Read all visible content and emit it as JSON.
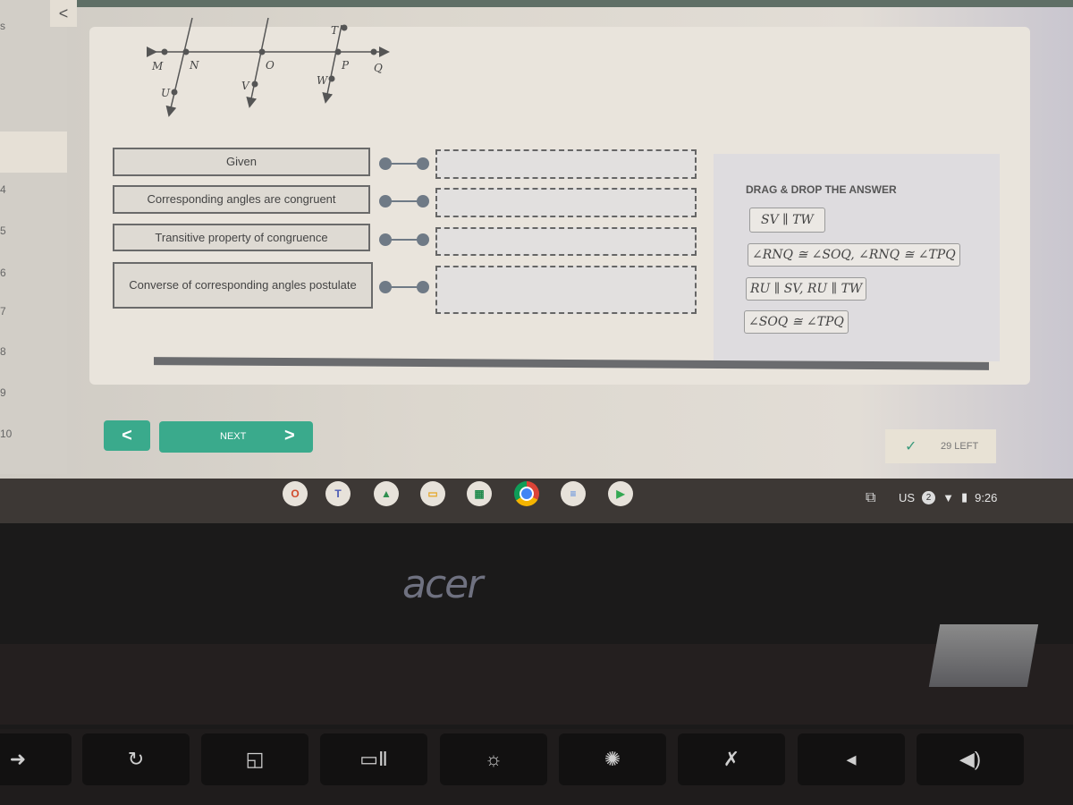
{
  "sidebar": {
    "collapse_label": "<",
    "partial_label": "s",
    "items": [
      "4",
      "5",
      "6",
      "7",
      "8",
      "9",
      "10"
    ]
  },
  "diagram": {
    "points": [
      "M",
      "N",
      "O",
      "P",
      "Q",
      "T",
      "U",
      "V",
      "W"
    ]
  },
  "proof": {
    "reasons": [
      "Given",
      "Corresponding angles are congruent",
      "Transitive property of congruence",
      "Converse of corresponding angles postulate"
    ],
    "statements": [
      "",
      "",
      "",
      ""
    ]
  },
  "answers": {
    "title": "DRAG & DROP THE ANSWER",
    "options": [
      "SV ∥ TW",
      "∠RNQ ≅ ∠SOQ, ∠RNQ ≅ ∠TPQ",
      "RU ∥ SV, RU ∥ TW",
      "∠SOQ ≅ ∠TPQ"
    ]
  },
  "navigation": {
    "prev_label": "<",
    "next_label": "NEXT",
    "next_arrow": ">"
  },
  "status": {
    "check_icon": "✓",
    "remaining": "29 LEFT"
  },
  "shelf": {
    "apps": [
      "office",
      "teams",
      "drive",
      "slides",
      "sheets",
      "chrome",
      "docs",
      "play-store"
    ],
    "ime": "US",
    "notifications": "2",
    "time": "9:26"
  },
  "hardware": {
    "brand": "acer"
  }
}
